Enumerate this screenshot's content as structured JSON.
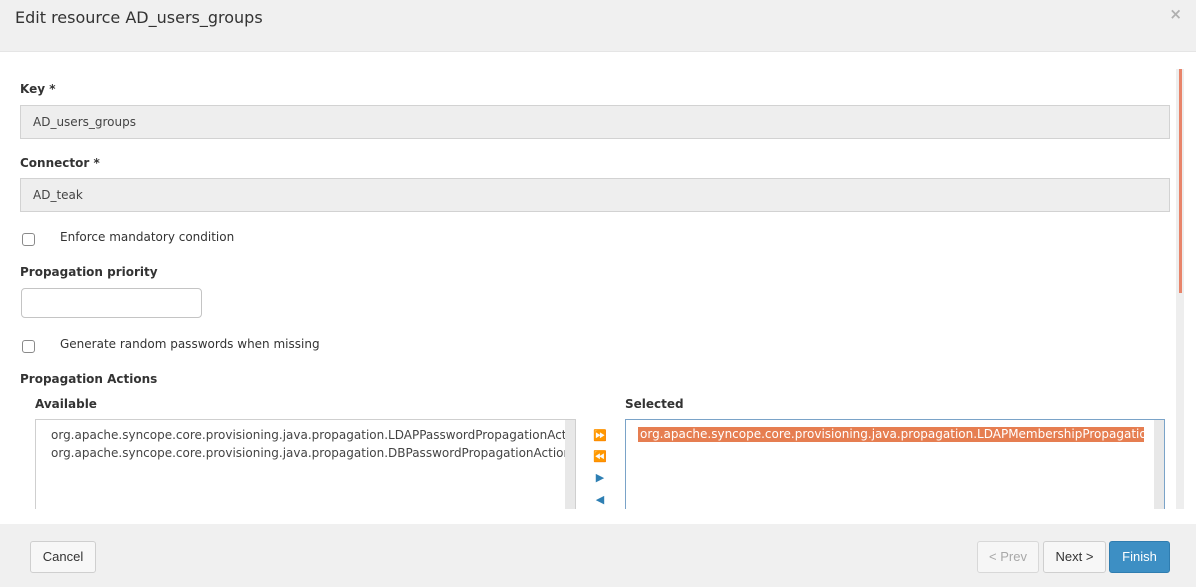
{
  "dialog": {
    "title": "Edit resource AD_users_groups",
    "close_label": "×"
  },
  "form": {
    "key": {
      "label": "Key *",
      "value": "AD_users_groups"
    },
    "connector": {
      "label": "Connector *",
      "value": "AD_teak"
    },
    "enforce_mandatory": {
      "label": "Enforce mandatory condition",
      "checked": false
    },
    "propagation_priority": {
      "label": "Propagation priority",
      "value": ""
    },
    "random_passwords": {
      "label": "Generate random passwords when missing",
      "checked": false
    },
    "propagation_actions": {
      "label": "Propagation Actions",
      "available_label": "Available",
      "selected_label": "Selected",
      "available": [
        "org.apache.syncope.core.provisioning.java.propagation.LDAPPasswordPropagationActions",
        "org.apache.syncope.core.provisioning.java.propagation.DBPasswordPropagationActions"
      ],
      "selected": [
        "org.apache.syncope.core.provisioning.java.propagation.LDAPMembershipPropagationActions"
      ],
      "controls": {
        "add_all": "⏩",
        "remove_all": "⏪",
        "add": "▶",
        "remove": "◀"
      }
    }
  },
  "footer": {
    "cancel": "Cancel",
    "prev": "< Prev",
    "next": "Next >",
    "finish": "Finish"
  },
  "colors": {
    "primary": "#3d8fc4",
    "selection": "#e67e51",
    "scroll_thumb": "#e8846a"
  }
}
